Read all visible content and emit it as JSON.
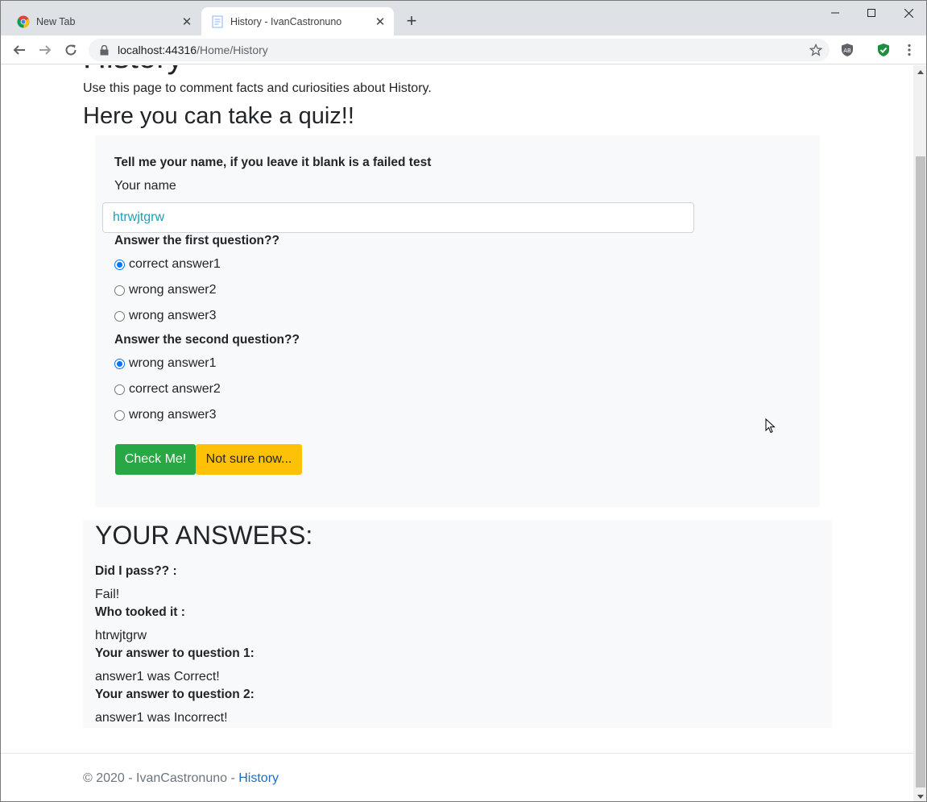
{
  "browser": {
    "tabs": [
      {
        "title": "New Tab",
        "icon": "chrome-icon"
      },
      {
        "title": "History - IvanCastronuno",
        "icon": "page-icon"
      }
    ],
    "address": {
      "host": "localhost:44316",
      "path": "/Home/History"
    }
  },
  "page": {
    "cut_heading": "History",
    "lead": "Use this page to comment facts and curiosities about History.",
    "quiz_heading": "Here you can take a quiz!!",
    "name_prompt": "Tell me your name, if you leave it blank is a failed test",
    "name_label": "Your name",
    "name_value": "htrwjtgrw",
    "q1": {
      "label": "Answer the first question??",
      "options": [
        "correct answer1",
        "wrong answer2",
        "wrong answer3"
      ],
      "selected": 0
    },
    "q2": {
      "label": "Answer the second question??",
      "options": [
        "wrong answer1",
        "correct answer2",
        "wrong answer3"
      ],
      "selected": 0
    },
    "buttons": {
      "check": "Check Me!",
      "unsure": "Not sure now..."
    },
    "answers": {
      "heading": "YOUR ANSWERS:",
      "pass_label": "Did I pass?? :",
      "pass_value": "Fail!",
      "who_label": "Who tooked it :",
      "who_value": "htrwjtgrw",
      "a1_label": "Your answer to question 1:",
      "a1_value": "answer1 was Correct!",
      "a2_label": "Your answer to question 2:",
      "a2_value": "answer1 was Incorrect!"
    },
    "footer": {
      "text": "© 2020 - IvanCastronuno -",
      "link": "History"
    }
  },
  "colors": {
    "success": "#28a745",
    "warning": "#ffc107",
    "link": "#1b6ec2",
    "radio": "#0075ff"
  }
}
